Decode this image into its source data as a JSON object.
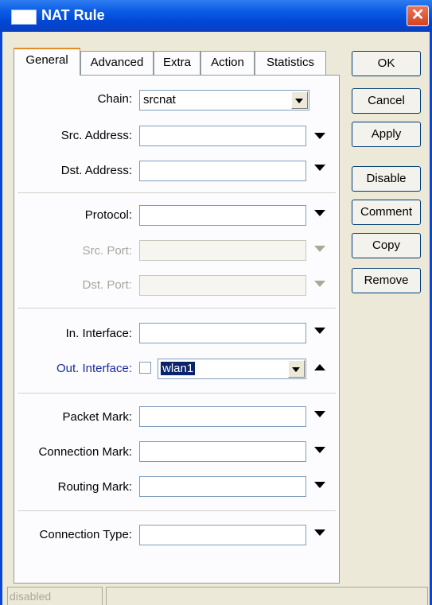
{
  "window": {
    "title": "NAT Rule",
    "close_glyph": "✕"
  },
  "tabs": [
    "General",
    "Advanced",
    "Extra",
    "Action",
    "Statistics"
  ],
  "form": {
    "chain_label": "Chain:",
    "chain_value": "srcnat",
    "src_address_label": "Src. Address:",
    "dst_address_label": "Dst. Address:",
    "protocol_label": "Protocol:",
    "src_port_label": "Src. Port:",
    "dst_port_label": "Dst. Port:",
    "in_interface_label": "In. Interface:",
    "out_interface_label": "Out. Interface:",
    "out_interface_value": "wlan1",
    "packet_mark_label": "Packet Mark:",
    "connection_mark_label": "Connection Mark:",
    "routing_mark_label": "Routing Mark:",
    "connection_type_label": "Connection Type:"
  },
  "buttons": {
    "ok": "OK",
    "cancel": "Cancel",
    "apply": "Apply",
    "disable": "Disable",
    "comment": "Comment",
    "copy": "Copy",
    "remove": "Remove"
  },
  "status": {
    "state": "disabled"
  },
  "colors": {
    "titlebar": "#0a46d5",
    "selection": "#0a246a",
    "active_tab_accent": "#e68b2c"
  }
}
